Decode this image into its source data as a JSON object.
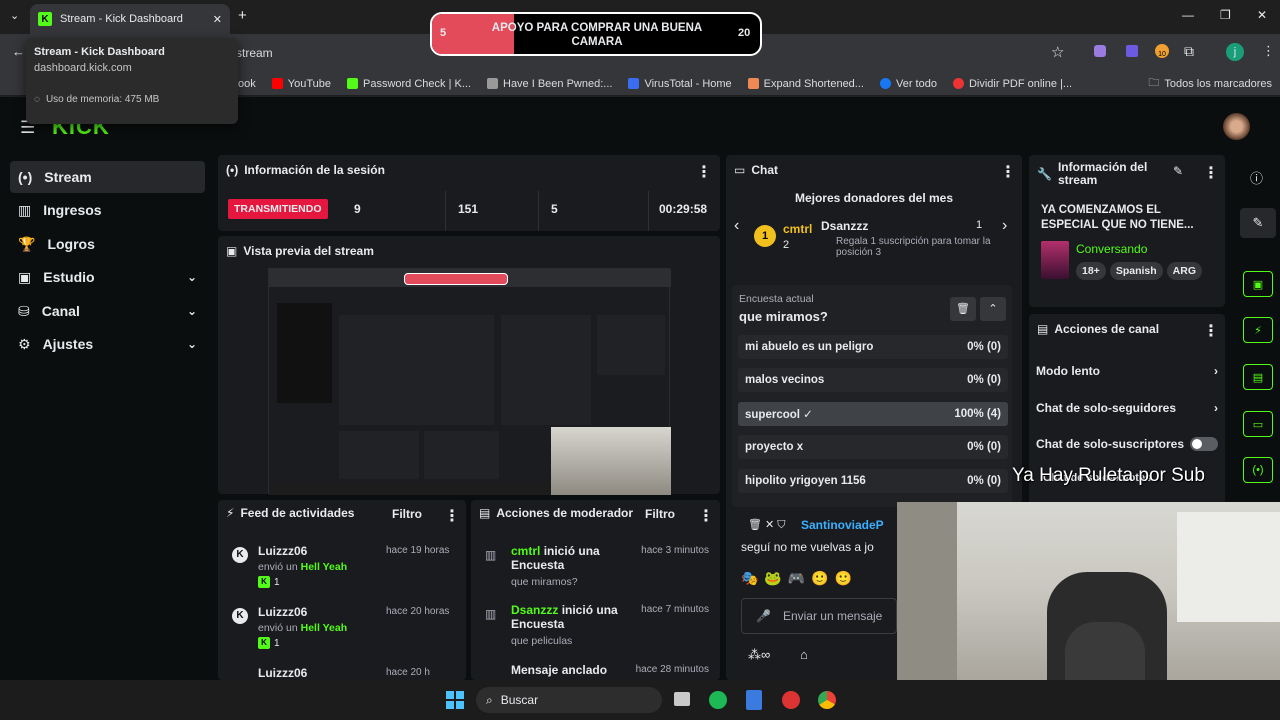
{
  "browser": {
    "tab_title": "Stream - Kick Dashboard",
    "new_tab": "+",
    "address": "stream",
    "tooltip": {
      "title": "Stream - Kick Dashboard",
      "url": "dashboard.kick.com",
      "memory": "Uso de memoria: 475 MB"
    },
    "bookmarks": [
      "ook",
      "YouTube",
      "Password Check | K...",
      "Have I Been Pwned:...",
      "VirusTotal - Home",
      "Expand Shortened...",
      "Ver todo",
      "Dividir PDF online |..."
    ],
    "bookmarks_right": "Todos los marcadores",
    "profile_letter": "j",
    "ext_badge": "10"
  },
  "overlay": {
    "left": "5",
    "text": "APOYO PARA COMPRAR UNA BUENA CAMARA",
    "right": "20",
    "progress": 0.25
  },
  "sidebar": {
    "items": [
      {
        "label": "Stream",
        "icon": "(•)"
      },
      {
        "label": "Ingresos",
        "icon": "▥"
      },
      {
        "label": "Logros",
        "icon": "🏆"
      },
      {
        "label": "Estudio",
        "icon": "▣"
      },
      {
        "label": "Canal",
        "icon": "⛁"
      },
      {
        "label": "Ajustes",
        "icon": "⚙"
      }
    ]
  },
  "session": {
    "title": "Información de la sesión",
    "live_badge": "TRANSMITIENDO",
    "stat1": "9",
    "stat2": "151",
    "stat3": "5",
    "time": "00:29:58"
  },
  "preview": {
    "title": "Vista previa del stream"
  },
  "feed": {
    "title": "Feed de actividades",
    "filter": "Filtro",
    "items": [
      {
        "user": "Luizzz06",
        "time": "hace 19 horas",
        "action": "envió un",
        "emote": "Hell Yeah",
        "count": "1"
      },
      {
        "user": "Luizzz06",
        "time": "hace 20 horas",
        "action": "envió un",
        "emote": "Hell Yeah",
        "count": "1"
      }
    ],
    "cut_user": "Luizzz06",
    "cut_time": "hace 20 h"
  },
  "mod": {
    "title": "Acciones de moderador",
    "filter": "Filtro",
    "items": [
      {
        "user": "cmtrl",
        "text": "inició una Encuesta",
        "time": "hace 3 minutos",
        "sub": "que miramos?"
      },
      {
        "user": "Dsanzzz",
        "text": "inició una Encuesta",
        "time": "hace 7 minutos",
        "sub": "que peliculas"
      }
    ],
    "cut_text": "Mensaje anclado",
    "cut_time": "hace 28 minutos"
  },
  "chat": {
    "title": "Chat",
    "donors_title": "Mejores donadores del mes",
    "donor1": {
      "rank": "1",
      "name": "cmtrl",
      "count": "2"
    },
    "donor2": {
      "name": "Dsanzzz",
      "count": "1",
      "note": "Regala 1 suscripción para tomar la posición 3"
    },
    "poll_label": "Encuesta actual",
    "poll_question": "que miramos?",
    "poll_options": [
      {
        "label": "mi abuelo es un peligro",
        "result": "0% (0)"
      },
      {
        "label": "malos vecinos",
        "result": "0% (0)"
      },
      {
        "label": "supercool",
        "result": "100% (4)"
      },
      {
        "label": "proyecto x",
        "result": "0% (0)"
      },
      {
        "label": "hipolito yrigoyen 1156",
        "result": "0% (0)"
      }
    ],
    "msg_user": "SantinoviadeP",
    "msg_text": "seguí no me vuelvas a jo",
    "input_placeholder": "Enviar un mensaje"
  },
  "stream_info": {
    "title": "Información del stream",
    "text": "YA COMENZAMOS EL ESPECIAL QUE NO TIENE...",
    "category": "Conversando",
    "tags": [
      "18+",
      "Spanish",
      "ARG"
    ]
  },
  "channel_actions": {
    "title": "Acciones de canal",
    "items": [
      "Modo lento",
      "Chat de solo-seguidores",
      "Chat de solo-suscriptores",
      "Chat de solo-emotes"
    ]
  },
  "overlay_text": "Ya Hay Ruleta por Sub",
  "taskbar": {
    "search": "Buscar"
  },
  "colors": {
    "kick_green": "#53fc18",
    "live_red": "#e5173f",
    "banner_fill": "#e34b5b"
  }
}
